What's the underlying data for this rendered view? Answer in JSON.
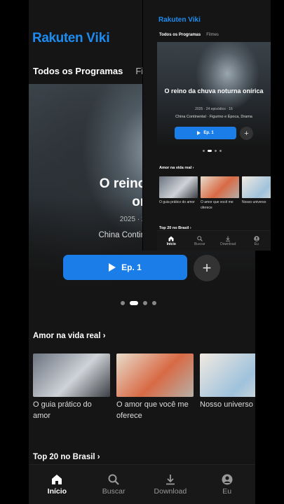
{
  "brand": {
    "name_part1": "Rakuten",
    "name_part2": "Viki",
    "color": "#1d8cf0"
  },
  "tabs": [
    {
      "label": "Todos os Programas",
      "active": true
    },
    {
      "label": "Filmes",
      "active": false
    }
  ],
  "hero_main": {
    "title": "O reino da chuva noturna onírica",
    "title_visible_line1": "O reino da ch",
    "title_visible_line2": "oní",
    "meta_visible": "2025 · 24 epis",
    "genre_visible": "China Continental · Figu",
    "episode_button": "Ep. 1",
    "add_button": "+"
  },
  "hero_mini": {
    "title": "O reino da chuva noturna onírica",
    "meta": "2025 · 24 episódios · 16",
    "genre": "China Continental · Figurino e Época, Drama",
    "episode_button": "Ep. 1",
    "add_button": "+"
  },
  "carousel": {
    "count": 4,
    "active_index": 1
  },
  "sections": {
    "amor": {
      "title": "Amor na vida real ›",
      "cards": [
        {
          "title": "O guia prático do amor",
          "colors": [
            "#6b7480",
            "#cfd3d8"
          ]
        },
        {
          "title": "O amor que você me oferece",
          "colors": [
            "#d86a45",
            "#e8dccb"
          ]
        },
        {
          "title": "Nosso universo",
          "colors": [
            "#9fc2dc",
            "#f1e9e0"
          ]
        }
      ]
    },
    "top20": {
      "title": "Top 20 no Brasil ›"
    }
  },
  "nav": [
    {
      "label": "Início",
      "icon": "home-icon",
      "active": true
    },
    {
      "label": "Buscar",
      "icon": "search-icon",
      "active": false
    },
    {
      "label": "Download",
      "icon": "download-icon",
      "active": false
    },
    {
      "label": "Eu",
      "icon": "profile-icon",
      "active": false
    }
  ],
  "accent_color": "#1b7ee8"
}
